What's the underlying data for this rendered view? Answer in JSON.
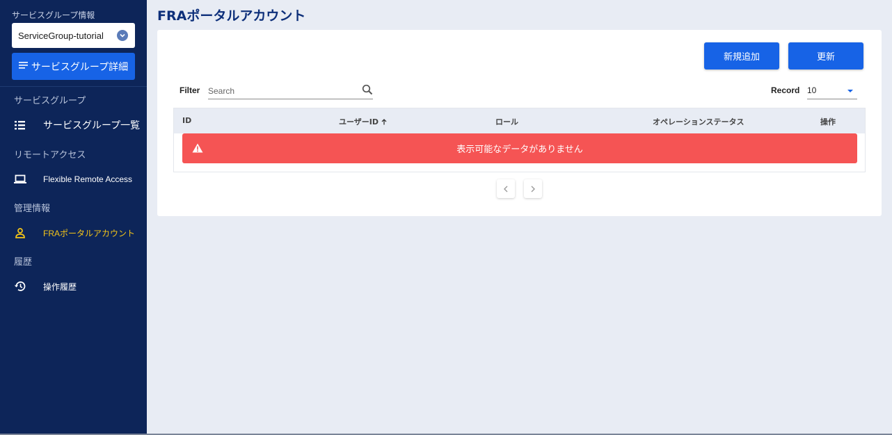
{
  "sidebar": {
    "service_group_info_label": "サービスグループ情報",
    "service_group_select": {
      "value": "ServiceGroup-tutorial",
      "icon": "chevron-down-circle-icon"
    },
    "detail_button": {
      "label": "サービスグループ詳細",
      "icon": "list-lines-icon"
    },
    "groups": [
      {
        "label": "サービスグループ",
        "items": [
          {
            "label": "サービスグループ一覧",
            "icon": "list-icon"
          }
        ]
      },
      {
        "label": "リモートアクセス",
        "items": [
          {
            "label": "Flexible Remote Access",
            "icon": "laptop-icon"
          }
        ]
      },
      {
        "label": "管理情報",
        "items": [
          {
            "label": "FRAポータルアカウント",
            "icon": "person-icon",
            "active": true
          }
        ]
      },
      {
        "label": "履歴",
        "items": [
          {
            "label": "操作履歴",
            "icon": "history-icon"
          }
        ]
      }
    ],
    "colors": {
      "background": "#0d2559",
      "active": "#f5c518"
    }
  },
  "main": {
    "title": "FRAポータルアカウント",
    "buttons": {
      "new": "新規追加",
      "refresh": "更新"
    },
    "filter": {
      "label": "Filter",
      "placeholder": "Search",
      "value": ""
    },
    "record": {
      "label": "Record",
      "value": "10"
    },
    "table": {
      "columns": [
        "ID",
        "ユーザーID",
        "ロール",
        "オペレーションステータス",
        "操作"
      ],
      "sort": {
        "column": "ユーザーID",
        "direction": "ascending"
      },
      "empty_message": "表示可能なデータがありません"
    },
    "colors": {
      "accent": "#1763e6",
      "alert": "#f55454",
      "title": "#0d2f7a"
    }
  }
}
